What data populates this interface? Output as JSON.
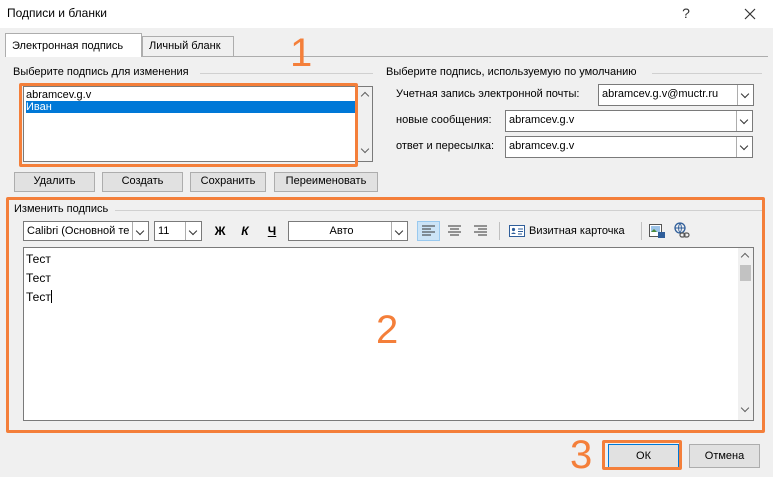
{
  "window": {
    "title": "Подписи и бланки",
    "help": "?",
    "close": "✕"
  },
  "tabs": [
    {
      "label": "Электронная подпись",
      "active": true
    },
    {
      "label": "Личный бланк",
      "active": false
    }
  ],
  "left_group": {
    "label": "Выберите подпись для изменения",
    "items": [
      {
        "label": "abramcev.g.v",
        "selected": false
      },
      {
        "label": "Иван",
        "selected": true
      }
    ],
    "buttons": {
      "delete": "Удалить",
      "create": "Создать",
      "save": "Сохранить",
      "rename": "Переименовать"
    }
  },
  "right_group": {
    "label": "Выберите подпись, используемую по умолчанию",
    "account_label": "Учетная запись электронной почты:",
    "account_value": "abramcev.g.v@muctr.ru",
    "new_label": "новые сообщения:",
    "new_value": "abramcev.g.v",
    "reply_label": "ответ и пересылка:",
    "reply_value": "abramcev.g.v"
  },
  "editor": {
    "label": "Изменить подпись",
    "font_name": "Calibri (Основной те",
    "font_size": "11",
    "bold": "Ж",
    "italic": "К",
    "underline": "Ч",
    "color": "Авто",
    "business_card": "Визитная карточка",
    "lines": [
      "Тест",
      "Тест",
      "Тест"
    ]
  },
  "footer": {
    "ok": "ОК",
    "cancel": "Отмена"
  },
  "annotations": [
    {
      "number": "1",
      "color": "#f47f3a"
    },
    {
      "number": "2",
      "color": "#f47f3a"
    },
    {
      "number": "3",
      "color": "#f47f3a"
    }
  ],
  "colors": {
    "accent": "#0078d7",
    "annotation": "#f47f3a"
  }
}
